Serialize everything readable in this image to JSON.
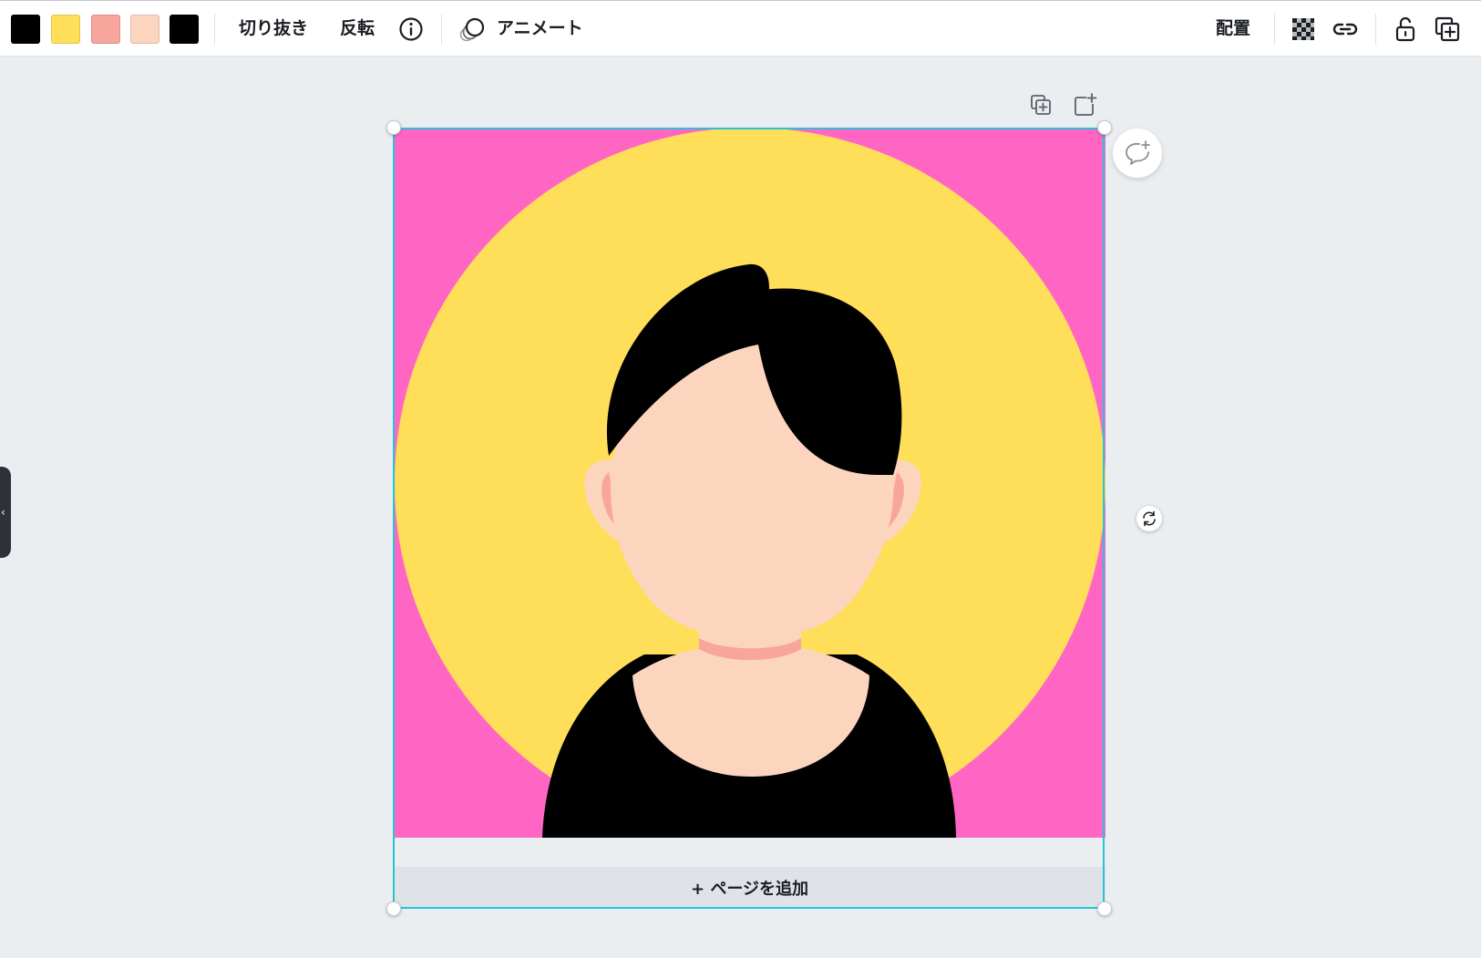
{
  "toolbar": {
    "swatches": [
      {
        "name": "black",
        "color": "#000000"
      },
      {
        "name": "yellow",
        "color": "#ffde59"
      },
      {
        "name": "salmon",
        "color": "#f8a59d"
      },
      {
        "name": "peach",
        "color": "#fcd5bf"
      },
      {
        "name": "black",
        "color": "#000000"
      }
    ],
    "crop_label": "切り抜き",
    "flip_label": "反転",
    "animate_label": "アニメート",
    "position_label": "配置",
    "icons": {
      "info": "info-icon",
      "animate": "animate-icon",
      "transparency": "transparency-icon",
      "link": "link-icon",
      "lock": "lock-icon",
      "duplicate": "duplicate-icon"
    }
  },
  "canvas": {
    "background_color": "#ff66c4",
    "circle_color": "#ffde59",
    "skin_color": "#fcd5bf",
    "shadow_color": "#f8a59d",
    "hair_color": "#000000",
    "shirt_color": "#000000"
  },
  "page_actions": {
    "add_page_label": "+ ページを追加",
    "icons": [
      "duplicate-page-icon",
      "add-page-icon",
      "comment-add-icon",
      "rotate-icon"
    ]
  },
  "selection_color": "#27c3d6",
  "side_panel_toggle": "‹"
}
